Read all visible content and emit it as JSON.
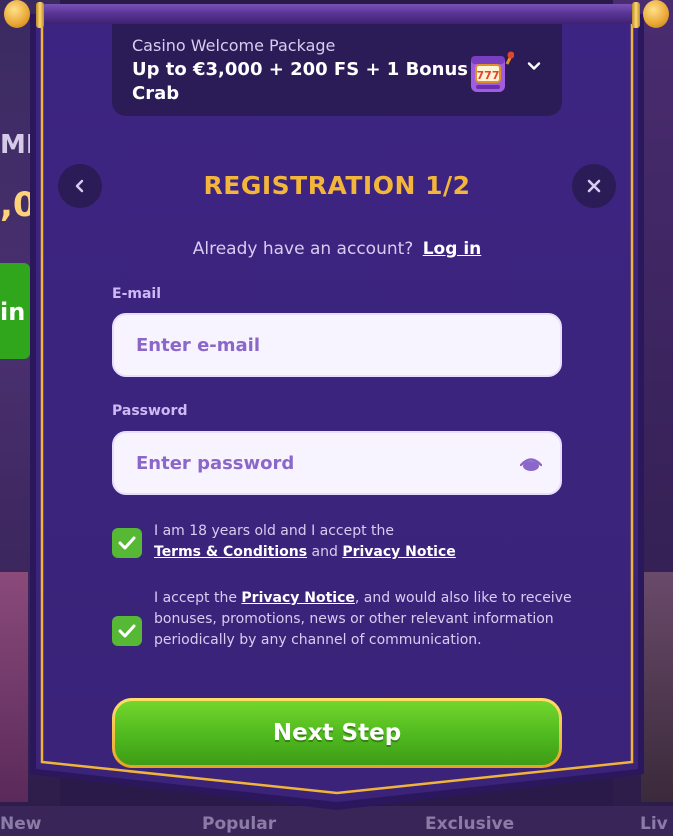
{
  "background": {
    "left_text_1": "MI",
    "left_text_2": ",0",
    "left_button_text": "in",
    "bottom_tabs": [
      "New",
      "Popular",
      "Exclusive",
      "Liv"
    ]
  },
  "promo": {
    "label": "Casino Welcome Package",
    "title": "Up to €3,000 + 200 FS + 1 Bonus Crab",
    "slot_icon": "slot-machine-777-icon",
    "expand_icon": "chevron-down-icon"
  },
  "header": {
    "back_icon": "chevron-left-icon",
    "title": "REGISTRATION 1/2",
    "close_icon": "close-icon"
  },
  "account": {
    "prompt": "Already have an account?",
    "login_link": "Log in"
  },
  "form": {
    "email_label": "E-mail",
    "email_placeholder": "Enter e-mail",
    "email_value": "",
    "password_label": "Password",
    "password_placeholder": "Enter password",
    "password_value": "",
    "password_toggle_icon": "eye-icon"
  },
  "consents": [
    {
      "checked": true,
      "text_before": "I am 18 years old and I accept the",
      "link1": "Terms & Conditions",
      "middle": "and",
      "link2": "Privacy Notice"
    },
    {
      "checked": true,
      "text_before": "I accept the",
      "link": "Privacy Notice",
      "text_after": ", and would also like to receive bonuses, promotions, news or other relevant information periodically by any channel of communication."
    }
  ],
  "next_button_label": "Next Step",
  "colors": {
    "panel": "#3d2580",
    "title": "#f4b63a",
    "button_green": "#56b834",
    "border_gold": "#f0b43a"
  }
}
